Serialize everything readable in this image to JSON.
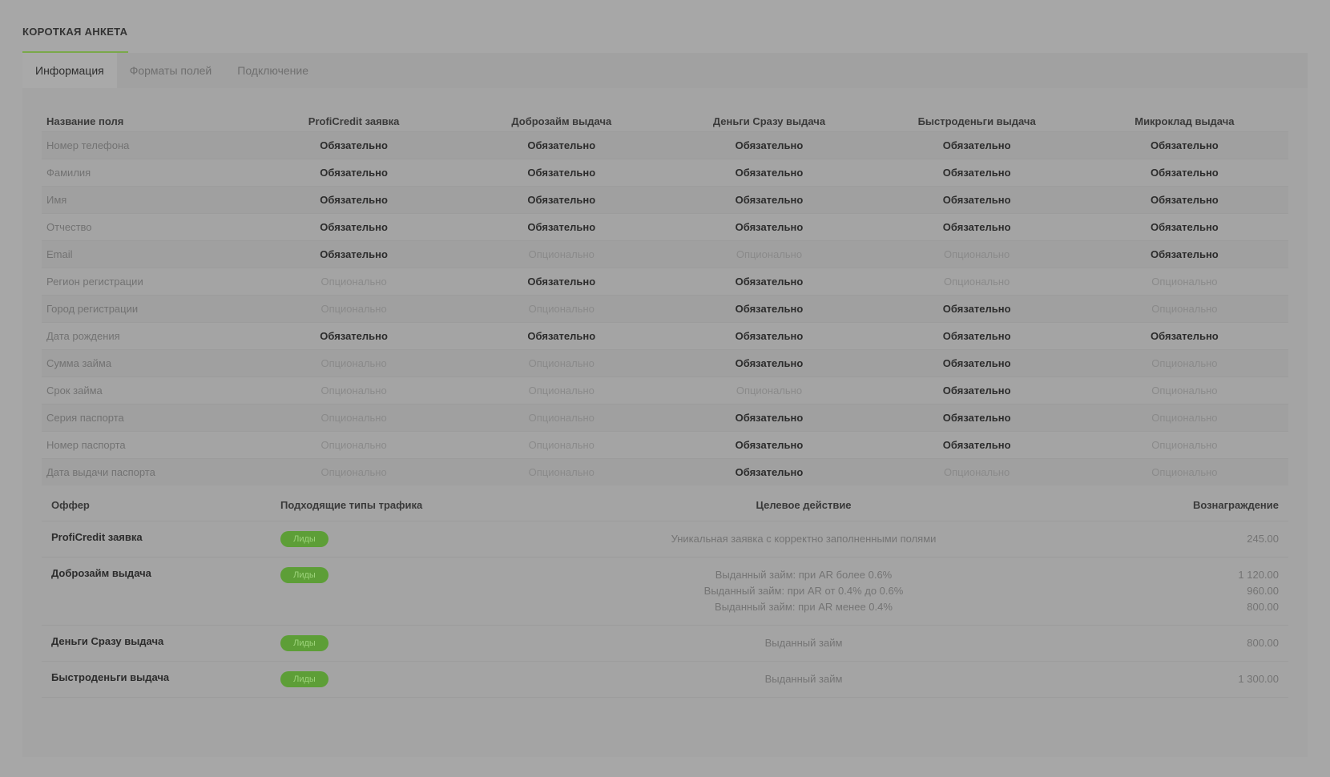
{
  "page": {
    "title": "КОРОТКАЯ АНКЕТА"
  },
  "tabs": [
    {
      "label": "Информация",
      "active": true
    },
    {
      "label": "Форматы полей",
      "active": false
    },
    {
      "label": "Подключение",
      "active": false
    }
  ],
  "fields_table": {
    "headers": [
      "Название поля",
      "ProfiCredit заявка",
      "Доброзайм выдача",
      "Деньги Сразу выдача",
      "Быстроденьги выдача",
      "Микроклад выдача"
    ],
    "rows": [
      {
        "name": "Номер телефона",
        "values": [
          "Обязательно",
          "Обязательно",
          "Обязательно",
          "Обязательно",
          "Обязательно"
        ]
      },
      {
        "name": "Фамилия",
        "values": [
          "Обязательно",
          "Обязательно",
          "Обязательно",
          "Обязательно",
          "Обязательно"
        ]
      },
      {
        "name": "Имя",
        "values": [
          "Обязательно",
          "Обязательно",
          "Обязательно",
          "Обязательно",
          "Обязательно"
        ]
      },
      {
        "name": "Отчество",
        "values": [
          "Обязательно",
          "Обязательно",
          "Обязательно",
          "Обязательно",
          "Обязательно"
        ]
      },
      {
        "name": "Email",
        "values": [
          "Обязательно",
          "Опционально",
          "Опционально",
          "Опционально",
          "Обязательно"
        ]
      },
      {
        "name": "Регион регистрации",
        "values": [
          "Опционально",
          "Обязательно",
          "Обязательно",
          "Опционально",
          "Опционально"
        ]
      },
      {
        "name": "Город регистрации",
        "values": [
          "Опционально",
          "Опционально",
          "Обязательно",
          "Обязательно",
          "Опционально"
        ]
      },
      {
        "name": "Дата рождения",
        "values": [
          "Обязательно",
          "Обязательно",
          "Обязательно",
          "Обязательно",
          "Обязательно"
        ]
      },
      {
        "name": "Сумма займа",
        "values": [
          "Опционально",
          "Опционально",
          "Обязательно",
          "Обязательно",
          "Опционально"
        ]
      },
      {
        "name": "Срок займа",
        "values": [
          "Опционально",
          "Опционально",
          "Опционально",
          "Обязательно",
          "Опционально"
        ]
      },
      {
        "name": "Серия паспорта",
        "values": [
          "Опционально",
          "Опционально",
          "Обязательно",
          "Обязательно",
          "Опционально"
        ]
      },
      {
        "name": "Номер паспорта",
        "values": [
          "Опционально",
          "Опционально",
          "Обязательно",
          "Обязательно",
          "Опционально"
        ]
      },
      {
        "name": "Дата выдачи паспорта",
        "values": [
          "Опционально",
          "Опционально",
          "Обязательно",
          "Опционально",
          "Опционально"
        ]
      }
    ]
  },
  "offers_table": {
    "headers": {
      "offer": "Оффер",
      "traffic": "Подходящие типы трафика",
      "action": "Целевое действие",
      "reward": "Вознаграждение"
    },
    "rows": [
      {
        "name": "ProfiCredit заявка",
        "badge": "Лиды",
        "actions": [
          "Уникальная заявка с корректно заполненными полями"
        ],
        "rewards": [
          "245.00"
        ]
      },
      {
        "name": "Доброзайм выдача",
        "badge": "Лиды",
        "actions": [
          "Выданный займ: при AR более 0.6%",
          "Выданный займ: при AR от 0.4% до 0.6%",
          "Выданный займ: при AR менее 0.4%"
        ],
        "rewards": [
          "1 120.00",
          "960.00",
          "800.00"
        ]
      },
      {
        "name": "Деньги Сразу выдача",
        "badge": "Лиды",
        "actions": [
          "Выданный займ"
        ],
        "rewards": [
          "800.00"
        ]
      },
      {
        "name": "Быстроденьги выдача",
        "badge": "Лиды",
        "actions": [
          "Выданный займ"
        ],
        "rewards": [
          "1 300.00"
        ]
      }
    ]
  },
  "colors": {
    "accent": "#7aa84a",
    "badge": "#5d9e37",
    "background": "#a7a7a7"
  }
}
